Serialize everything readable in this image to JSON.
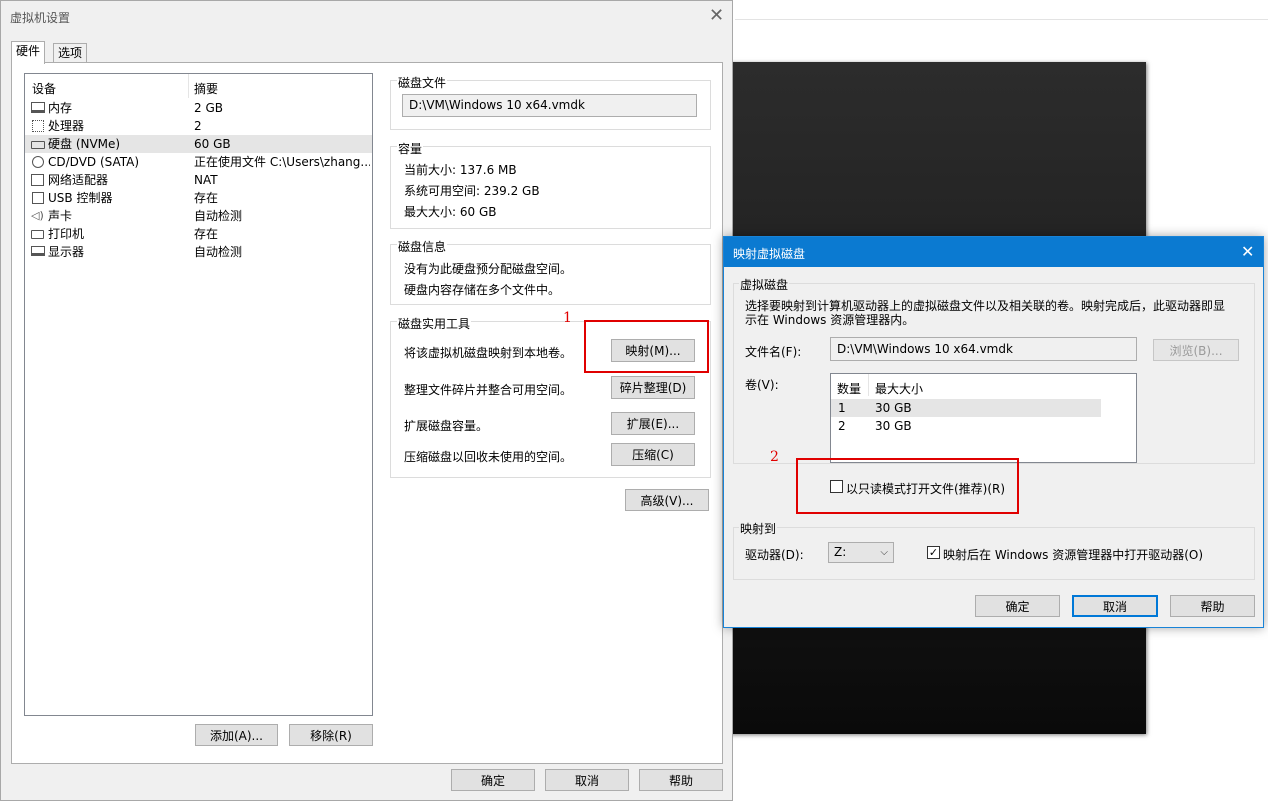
{
  "main_dialog": {
    "title": "虚拟机设置",
    "tabs": [
      "硬件",
      "选项"
    ],
    "device_list": {
      "headers": [
        "设备",
        "摘要"
      ],
      "rows": [
        {
          "name": "内存",
          "summary": "2 GB",
          "icon": "memory-icon"
        },
        {
          "name": "处理器",
          "summary": "2",
          "icon": "processor-icon"
        },
        {
          "name": "硬盘 (NVMe)",
          "summary": "60 GB",
          "icon": "hard-disk-icon"
        },
        {
          "name": "CD/DVD (SATA)",
          "summary": "正在使用文件 C:\\Users\\zhang...",
          "icon": "cd-dvd-icon"
        },
        {
          "name": "网络适配器",
          "summary": "NAT",
          "icon": "network-adapter-icon"
        },
        {
          "name": "USB 控制器",
          "summary": "存在",
          "icon": "usb-controller-icon"
        },
        {
          "name": "声卡",
          "summary": "自动检测",
          "icon": "sound-card-icon"
        },
        {
          "name": "打印机",
          "summary": "存在",
          "icon": "printer-icon"
        },
        {
          "name": "显示器",
          "summary": "自动检测",
          "icon": "display-icon"
        }
      ],
      "selected_index": 2
    },
    "add_button": "添加(A)...",
    "remove_button": "移除(R)",
    "disk_file": {
      "label": "磁盘文件",
      "value": "D:\\VM\\Windows 10 x64.vmdk"
    },
    "capacity": {
      "label": "容量",
      "current_size": "当前大小: 137.6 MB",
      "free_space": "系统可用空间: 239.2 GB",
      "max_size": "最大大小: 60 GB"
    },
    "disk_info": {
      "label": "磁盘信息",
      "line1": "没有为此硬盘预分配磁盘空间。",
      "line2": "硬盘内容存储在多个文件中。"
    },
    "disk_utilities": {
      "label": "磁盘实用工具",
      "map_text": "将该虚拟机磁盘映射到本地卷。",
      "map_button": "映射(M)...",
      "defrag_text": "整理文件碎片并整合可用空间。",
      "defrag_button": "碎片整理(D)",
      "expand_text": "扩展磁盘容量。",
      "expand_button": "扩展(E)...",
      "compact_text": "压缩磁盘以回收未使用的空间。",
      "compact_button": "压缩(C)"
    },
    "advanced_button": "高级(V)...",
    "ok_button": "确定",
    "cancel_button": "取消",
    "help_button": "帮助"
  },
  "map_dialog": {
    "title": "映射虚拟磁盘",
    "virtual_disk_label": "虚拟磁盘",
    "description_line1": "选择要映射到计算机驱动器上的虚拟磁盘文件以及相关联的卷。映射完成后，此驱动器即显",
    "description_line2": "示在 Windows 资源管理器内。",
    "filename_label": "文件名(F):",
    "filename_value": "D:\\VM\\Windows 10 x64.vmdk",
    "browse_button": "浏览(B)...",
    "volume_label": "卷(V):",
    "volume_headers": [
      "数量",
      "最大大小"
    ],
    "volumes": [
      {
        "num": "1",
        "size": "30 GB"
      },
      {
        "num": "2",
        "size": "30 GB"
      }
    ],
    "readonly_checkbox_label": "以只读模式打开文件(推荐)(R)",
    "readonly_checked": false,
    "map_to_label": "映射到",
    "drive_label": "驱动器(D):",
    "drive_value": "Z:",
    "open_explorer_label": "映射后在 Windows 资源管理器中打开驱动器(O)",
    "open_explorer_checked": true,
    "ok_button": "确定",
    "cancel_button": "取消",
    "help_button": "帮助"
  },
  "annotations": {
    "marker1": "1",
    "marker2": "2"
  },
  "colors": {
    "accent": "#0b7ad1",
    "annotation": "#e00000",
    "selection": "#e5e5e5"
  }
}
